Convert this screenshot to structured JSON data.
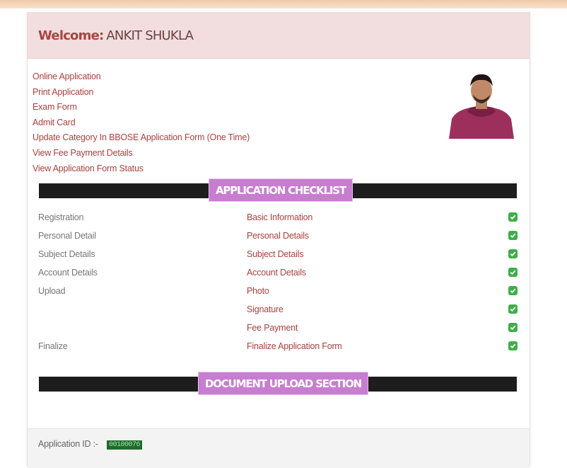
{
  "header": {
    "welcome_label": "Welcome:",
    "user_name": "ANKIT SHUKLA"
  },
  "links": [
    "Online Application",
    "Print Application",
    "Exam Form",
    "Admit Card",
    "Update Category In BBOSE Application Form (One Time)",
    "View Fee Payment Details",
    "View Application Form Status"
  ],
  "checklist": {
    "title": "APPLICATION CHECKLIST",
    "rows": [
      {
        "section": "Registration",
        "item": "Basic Information"
      },
      {
        "section": "Personal Detail",
        "item": "Personal Details"
      },
      {
        "section": "Subject Details",
        "item": "Subject Details"
      },
      {
        "section": "Account Details",
        "item": "Account Details"
      },
      {
        "section": "Upload",
        "item": "Photo"
      },
      {
        "section": "",
        "item": "Signature"
      },
      {
        "section": "",
        "item": "Fee Payment"
      },
      {
        "section": "Finalize",
        "item": "Finalize Application Form"
      }
    ]
  },
  "documents": {
    "title": "DOCUMENT UPLOAD SECTION"
  },
  "footer": {
    "application_id_label": "Application ID :-",
    "application_id_value": "00100076"
  },
  "colors": {
    "link": "#a8413f",
    "welcome_bg": "#f2dede",
    "section_label_bg": "#c77dd0",
    "check_green": "#3fae49"
  }
}
